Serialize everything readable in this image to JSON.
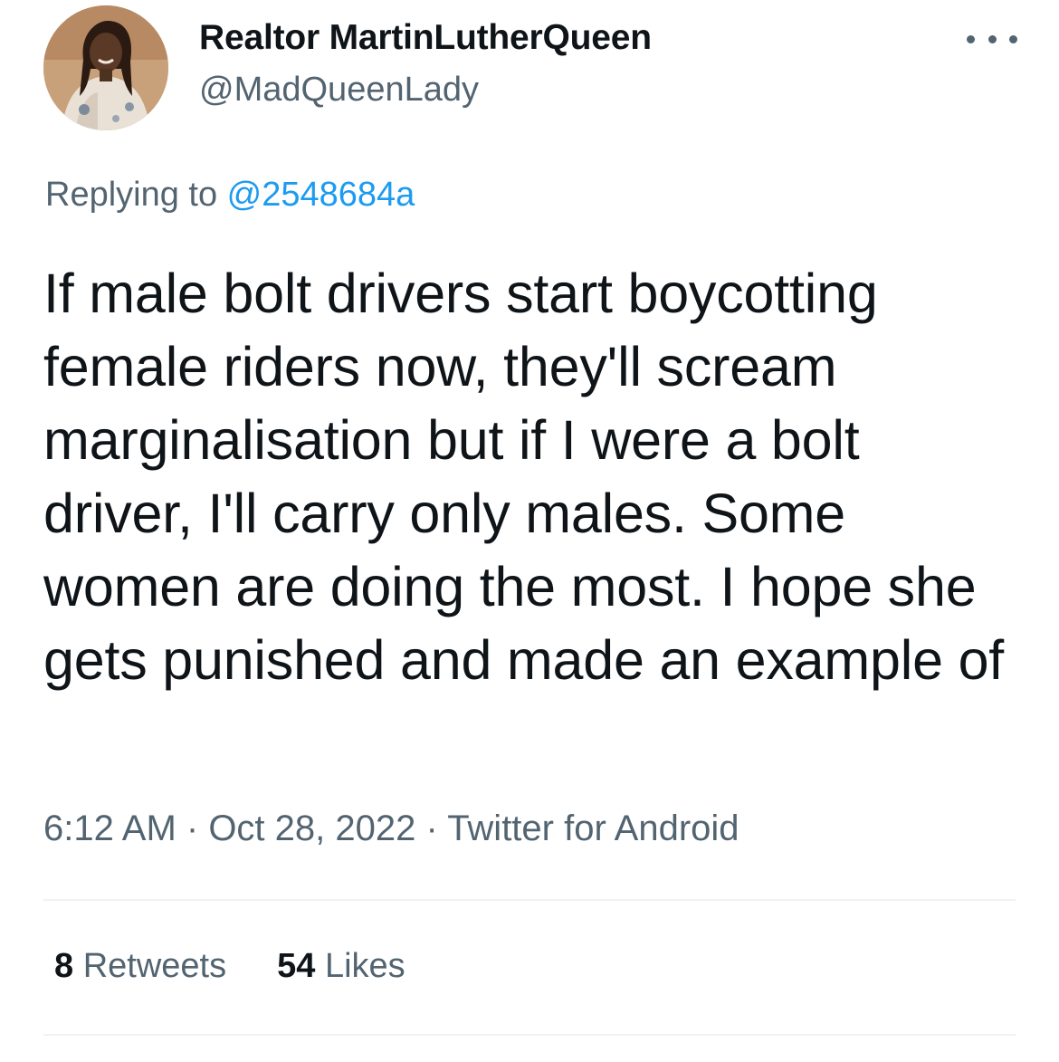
{
  "author": {
    "display_name": "Realtor MartinLutherQueen",
    "handle": "@MadQueenLady",
    "avatar_icon": "profile-photo"
  },
  "more_icon": "more-dots-icon",
  "reply": {
    "prefix": "Replying to ",
    "mention": "@2548684a"
  },
  "tweet": {
    "text": "If male bolt drivers start boycotting female riders now, they'll scream marginalisation but if I were a bolt driver, I'll carry only males. Some women are doing the most. I hope she gets punished and made an example of"
  },
  "meta": {
    "time": "6:12 AM",
    "separator": " · ",
    "date": "Oct 28, 2022",
    "source": "Twitter for Android"
  },
  "stats": {
    "retweets_count": "8",
    "retweets_label": " Retweets",
    "likes_count": "54",
    "likes_label": " Likes"
  },
  "colors": {
    "text_primary": "#0f1419",
    "text_secondary": "#536471",
    "link": "#1d9bf0",
    "divider": "#eff3f4"
  }
}
